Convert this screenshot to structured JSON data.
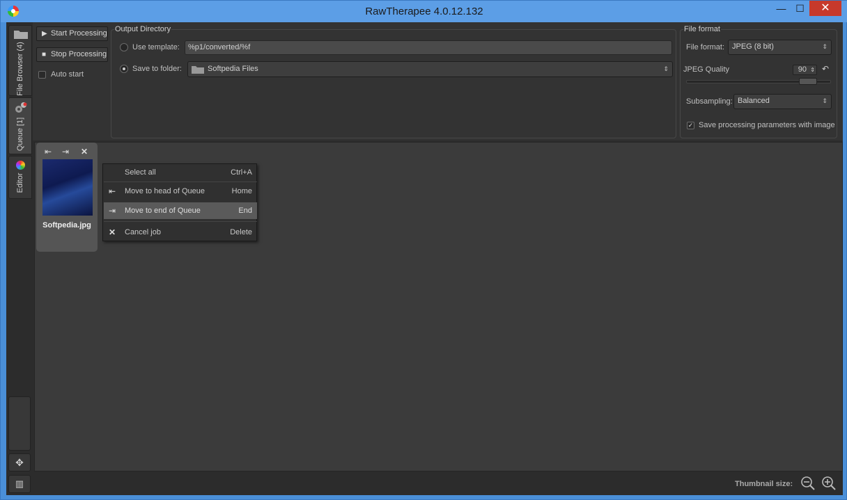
{
  "window": {
    "title": "RawTherapee 4.0.12.132",
    "minimize": "—",
    "maximize": "☐",
    "close": "✕"
  },
  "sidebar": {
    "tabs": [
      {
        "label": "File Browser (4)",
        "icon": "folder-icon"
      },
      {
        "label": "Queue [1]",
        "icon": "gears-icon"
      },
      {
        "label": "Editor",
        "icon": "color-wheel-icon"
      }
    ]
  },
  "queue_controls": {
    "start_label": "Start Processing",
    "stop_label": "Stop Processing",
    "auto_start_label": "Auto start"
  },
  "output_directory": {
    "title": "Output Directory",
    "use_template_label": "Use template:",
    "template_value": "%p1/converted/%f",
    "save_to_folder_label": "Save to folder:",
    "folder_value": "Softpedia Files"
  },
  "file_format": {
    "title": "File format",
    "format_label": "File format:",
    "format_value": "JPEG (8 bit)",
    "quality_label": "JPEG Quality",
    "quality_value": "90",
    "subsampling_label": "Subsampling:",
    "subsampling_value": "Balanced",
    "save_params_label": "Save processing parameters with image"
  },
  "queue": {
    "thumbnail": {
      "filename": "Softpedia.jpg"
    }
  },
  "context_menu": {
    "items": [
      {
        "label": "Select all",
        "shortcut": "Ctrl+A"
      },
      {
        "label": "Move to head of Queue",
        "shortcut": "Home"
      },
      {
        "label": "Move to end of Queue",
        "shortcut": "End"
      },
      {
        "label": "Cancel job",
        "shortcut": "Delete"
      }
    ]
  },
  "statusbar": {
    "thumbnail_size_label": "Thumbnail size:"
  }
}
